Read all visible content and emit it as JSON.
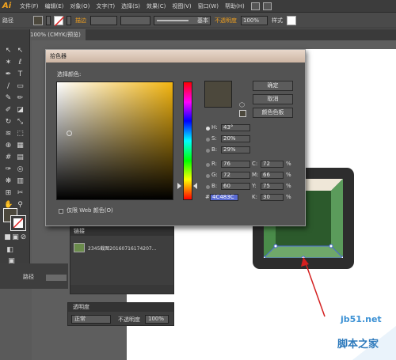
{
  "app": {
    "logo": "Ai"
  },
  "menu": [
    "文件(F)",
    "编辑(E)",
    "对象(O)",
    "文字(T)",
    "选择(S)",
    "效果(C)",
    "视图(V)",
    "窗口(W)",
    "帮助(H)"
  ],
  "controlbar": {
    "path_label": "路径",
    "stroke_label": "描边",
    "stroke_style": "基本",
    "opacity_label": "不透明度",
    "opacity_value": "100%",
    "style_label": "样式"
  },
  "document_tab": {
    "title": "100% (CMYK/预览)"
  },
  "color_picker": {
    "title": "拾色器",
    "select_label": "选择颜色:",
    "ok_label": "确定",
    "cancel_label": "取消",
    "swatches_label": "颜色色板",
    "web_only_label": "仅限 Web 颜色(O)",
    "fields": {
      "H": {
        "label": "H:",
        "value": "43°"
      },
      "S": {
        "label": "S:",
        "value": "20%"
      },
      "B": {
        "label": "B:",
        "value": "29%"
      },
      "R": {
        "label": "R:",
        "value": "76"
      },
      "G": {
        "label": "G:",
        "value": "72"
      },
      "Bl": {
        "label": "B:",
        "value": "60"
      },
      "C": {
        "label": "C:",
        "value": "72"
      },
      "M": {
        "label": "M:",
        "value": "66"
      },
      "Y": {
        "label": "Y:",
        "value": "75"
      },
      "K": {
        "label": "K:",
        "value": "30"
      },
      "hex": {
        "label": "#",
        "value": "4C483C"
      }
    },
    "percent": "%",
    "selected_color": "#4c483c"
  },
  "links_panel": {
    "tab": "链接",
    "file_name": "2345截图20160716174207..."
  },
  "pathfinder_panel": {
    "label": "路径"
  },
  "transparency_panel": {
    "tab": "透明度",
    "blend_mode": "正常",
    "opacity_label": "不透明度",
    "opacity_value": "100%"
  },
  "watermark": {
    "line1": "jb51.net",
    "line2": "脚本之家"
  }
}
